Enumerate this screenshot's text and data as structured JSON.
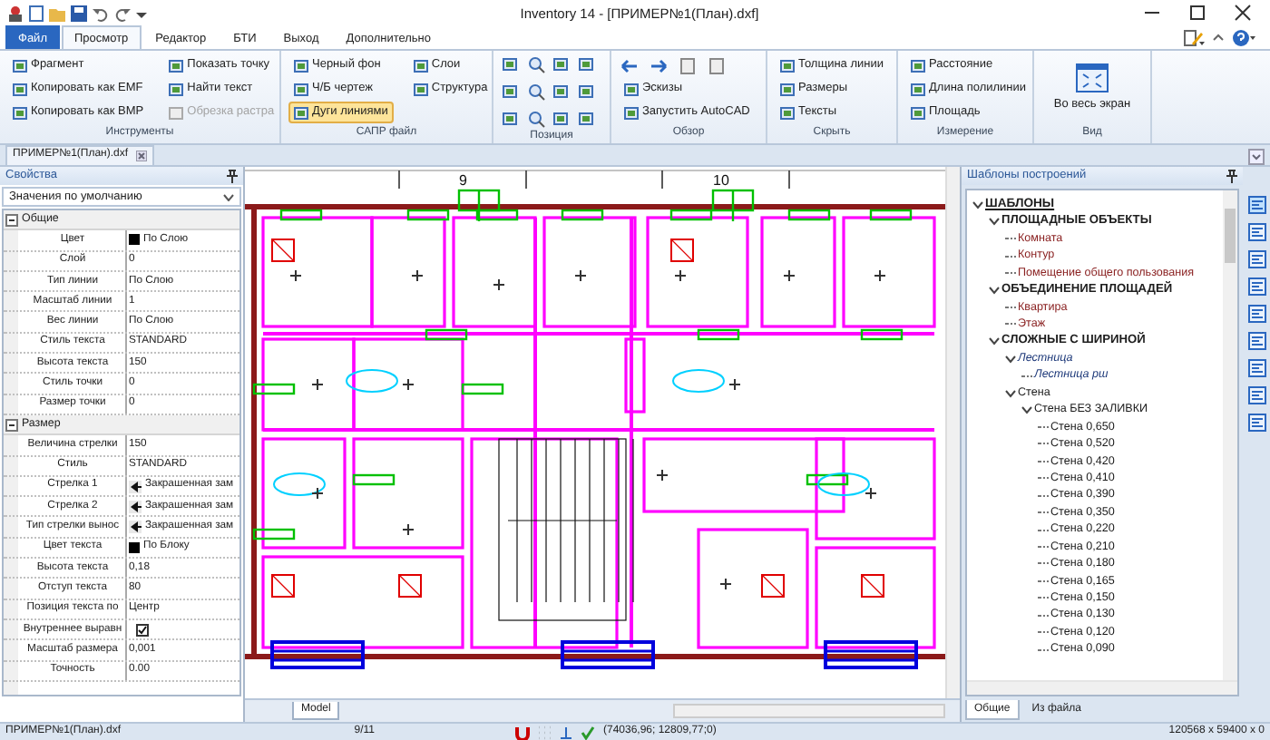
{
  "window": {
    "title": "Inventory 14 - [ПРИМЕР№1(План).dxf]"
  },
  "ribbon_tabs": [
    {
      "label": "Файл",
      "kind": "file",
      "selected": false
    },
    {
      "label": "Просмотр",
      "kind": "tab",
      "selected": true
    },
    {
      "label": "Редактор",
      "kind": "tab",
      "selected": false
    },
    {
      "label": "БТИ",
      "kind": "tab",
      "selected": false
    },
    {
      "label": "Выход",
      "kind": "tab",
      "selected": false
    },
    {
      "label": "Дополнительно",
      "kind": "tab",
      "selected": false
    }
  ],
  "ribbon_groups": [
    {
      "label": "Инструменты",
      "kind": "list",
      "columns": [
        [
          {
            "label": "Фрагмент",
            "disabled": false,
            "on": false
          },
          {
            "label": "Копировать как EMF",
            "disabled": false,
            "on": false
          },
          {
            "label": "Копировать как BMP",
            "disabled": false,
            "on": false
          }
        ],
        [
          {
            "label": "Показать точку",
            "disabled": false,
            "on": false
          },
          {
            "label": "Найти текст",
            "disabled": false,
            "on": false
          },
          {
            "label": "Обрезка растра",
            "disabled": true,
            "on": false
          }
        ]
      ]
    },
    {
      "label": "САПР файл",
      "kind": "list",
      "columns": [
        [
          {
            "label": "Черный фон",
            "disabled": false,
            "on": false
          },
          {
            "label": "Ч/Б чертеж",
            "disabled": false,
            "on": false
          },
          {
            "label": "Дуги линиями",
            "disabled": false,
            "on": true
          }
        ],
        [
          {
            "label": "Слои",
            "disabled": false,
            "on": false
          },
          {
            "label": "Структура",
            "disabled": false,
            "on": false
          }
        ]
      ]
    },
    {
      "label": "Позиция",
      "kind": "icons"
    },
    {
      "label": "Обзор",
      "kind": "nav",
      "columns": [
        [
          {
            "label": "Эскизы",
            "disabled": false,
            "on": false
          },
          {
            "label": "Запустить AutoCAD",
            "disabled": false,
            "on": false
          }
        ]
      ]
    },
    {
      "label": "Скрыть",
      "kind": "list",
      "columns": [
        [
          {
            "label": "Толщина линии",
            "disabled": false,
            "on": false
          },
          {
            "label": "Размеры",
            "disabled": false,
            "on": false
          },
          {
            "label": "Тексты",
            "disabled": false,
            "on": false
          }
        ]
      ]
    },
    {
      "label": "Измерение",
      "kind": "list",
      "columns": [
        [
          {
            "label": "Расстояние",
            "disabled": false,
            "on": false
          },
          {
            "label": "Длина полилинии",
            "disabled": false,
            "on": false
          },
          {
            "label": "Площадь",
            "disabled": false,
            "on": false
          }
        ]
      ]
    },
    {
      "label": "Вид",
      "kind": "large",
      "columns": [
        [
          {
            "label": "Во весь экран",
            "disabled": false,
            "on": false
          }
        ]
      ]
    }
  ],
  "document_tab": {
    "label": "ПРИМЕР№1(План).dxf"
  },
  "properties": {
    "title": "Свойства",
    "preset": "Значения по умолчанию",
    "categories": [
      {
        "name": "Общие",
        "expanded": true,
        "rows": [
          {
            "name": "Цвет",
            "value": "По Слою",
            "kind": "color",
            "color": "#000000"
          },
          {
            "name": "Слой",
            "value": "0",
            "kind": "text"
          },
          {
            "name": "Тип линии",
            "value": "По Слою",
            "kind": "text"
          },
          {
            "name": "Масштаб линии",
            "value": "1",
            "kind": "text"
          },
          {
            "name": "Вес линии",
            "value": "По Слою",
            "kind": "text"
          },
          {
            "name": "Стиль текста",
            "value": "STANDARD",
            "kind": "text"
          },
          {
            "name": "Высота текста",
            "value": "150",
            "kind": "text"
          },
          {
            "name": "Стиль точки",
            "value": "0",
            "kind": "text"
          },
          {
            "name": "Размер точки",
            "value": "0",
            "kind": "text"
          }
        ]
      },
      {
        "name": "Размер",
        "expanded": true,
        "rows": [
          {
            "name": "Величина стрелки",
            "value": "150",
            "kind": "text"
          },
          {
            "name": "Стиль",
            "value": "STANDARD",
            "kind": "text"
          },
          {
            "name": "Стрелка 1",
            "value": "Закрашенная зам",
            "kind": "arrow"
          },
          {
            "name": "Стрелка 2",
            "value": "Закрашенная зам",
            "kind": "arrow"
          },
          {
            "name": "Тип стрелки вынос",
            "value": "Закрашенная зам",
            "kind": "arrow"
          },
          {
            "name": "Цвет текста",
            "value": "По Блоку",
            "kind": "color",
            "color": "#000000"
          },
          {
            "name": "Высота текста",
            "value": "0,18",
            "kind": "text"
          },
          {
            "name": "Отступ текста",
            "value": "80",
            "kind": "text"
          },
          {
            "name": "Позиция текста по",
            "value": "Центр",
            "kind": "text"
          },
          {
            "name": "Внутреннее выравн",
            "kind": "check",
            "checked": true
          },
          {
            "name": "Масштаб размера",
            "value": "0,001",
            "kind": "text"
          },
          {
            "name": "Точность",
            "value": "0.00",
            "kind": "text"
          }
        ]
      }
    ]
  },
  "drawing": {
    "axis_labels": [
      "9",
      "10"
    ],
    "layout_tab": "Model"
  },
  "templates": {
    "title": "Шаблоны построений",
    "tree": [
      {
        "label": "ШАБЛОНЫ",
        "kind": "root",
        "expanded": true,
        "children": [
          {
            "label": "ПЛОЩАДНЫЕ ОБЪЕКТЫ",
            "kind": "section",
            "expanded": true,
            "children": [
              {
                "label": "Комната",
                "kind": "item"
              },
              {
                "label": "Контур",
                "kind": "item"
              },
              {
                "label": "Помещение общего пользования",
                "kind": "item"
              }
            ]
          },
          {
            "label": "ОБЪЕДИНЕНИЕ ПЛОЩАДЕЙ",
            "kind": "section",
            "expanded": true,
            "children": [
              {
                "label": "Квартира",
                "kind": "item"
              },
              {
                "label": "Этаж",
                "kind": "item"
              }
            ]
          },
          {
            "label": "СЛОЖНЫЕ С ШИРИНОЙ",
            "kind": "section",
            "expanded": true,
            "children": [
              {
                "label": "Лестница",
                "kind": "line",
                "expanded": true,
                "children": [
                  {
                    "label": "Лестница рш",
                    "kind": "line"
                  }
                ]
              },
              {
                "label": "Стена",
                "kind": "plain",
                "expanded": true,
                "children": [
                  {
                    "label": "Стена БЕЗ ЗАЛИВКИ",
                    "kind": "plain",
                    "expanded": true,
                    "children": [
                      {
                        "label": "Стена 0,650",
                        "kind": "plain"
                      },
                      {
                        "label": "Стена 0,520",
                        "kind": "plain"
                      },
                      {
                        "label": "Стена 0,420",
                        "kind": "plain"
                      },
                      {
                        "label": "Стена 0,410",
                        "kind": "plain"
                      },
                      {
                        "label": "Стена 0,390",
                        "kind": "plain"
                      },
                      {
                        "label": "Стена 0,350",
                        "kind": "plain"
                      },
                      {
                        "label": "Стена 0,220",
                        "kind": "plain"
                      },
                      {
                        "label": "Стена 0,210",
                        "kind": "plain"
                      },
                      {
                        "label": "Стена 0,180",
                        "kind": "plain"
                      },
                      {
                        "label": "Стена 0,165",
                        "kind": "plain"
                      },
                      {
                        "label": "Стена 0,150",
                        "kind": "plain"
                      },
                      {
                        "label": "Стена 0,130",
                        "kind": "plain"
                      },
                      {
                        "label": "Стена 0,120",
                        "kind": "plain"
                      },
                      {
                        "label": "Стена 0,090",
                        "kind": "plain"
                      }
                    ]
                  }
                ]
              }
            ]
          }
        ]
      }
    ],
    "tabs": [
      {
        "label": "Общие",
        "selected": true
      },
      {
        "label": "Из файла",
        "selected": false
      }
    ]
  },
  "status_bar": {
    "file": "ПРИМЕР№1(План).dxf",
    "page": "9/11",
    "coordinates": "(74036,96; 12809,77;0)",
    "extents": "120568 x 59400 x 0"
  }
}
